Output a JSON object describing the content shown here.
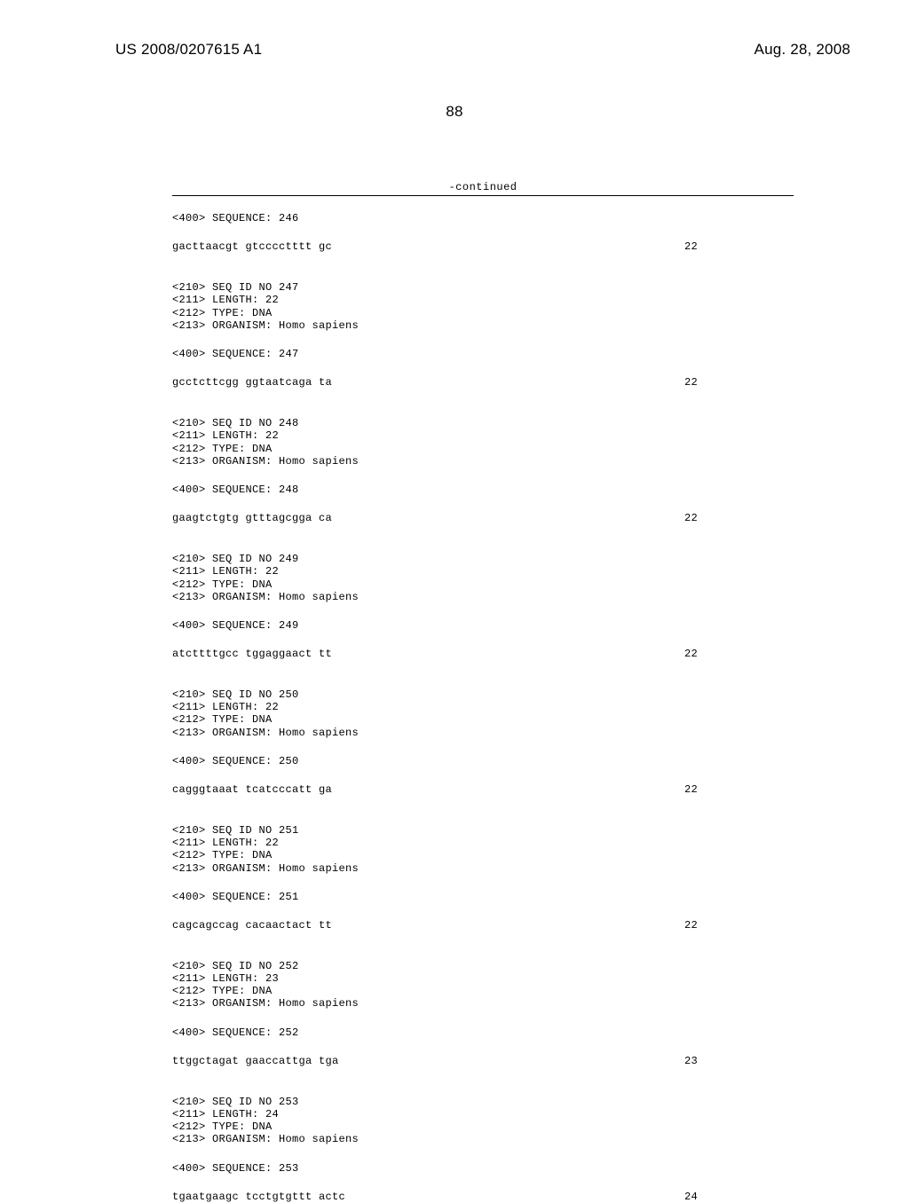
{
  "header": {
    "pub_number": "US 2008/0207615 A1",
    "pub_date": "Aug. 28, 2008"
  },
  "page_number": "88",
  "continued_label": "-continued",
  "sequences": [
    {
      "pre_header": [],
      "seq_label": "<400> SEQUENCE: 246",
      "seq_text": "gacttaacgt gtcccctttt gc",
      "seq_len": "22"
    },
    {
      "pre_header": [
        "<210> SEQ ID NO 247",
        "<211> LENGTH: 22",
        "<212> TYPE: DNA",
        "<213> ORGANISM: Homo sapiens"
      ],
      "seq_label": "<400> SEQUENCE: 247",
      "seq_text": "gcctcttcgg ggtaatcaga ta",
      "seq_len": "22"
    },
    {
      "pre_header": [
        "<210> SEQ ID NO 248",
        "<211> LENGTH: 22",
        "<212> TYPE: DNA",
        "<213> ORGANISM: Homo sapiens"
      ],
      "seq_label": "<400> SEQUENCE: 248",
      "seq_text": "gaagtctgtg gtttagcgga ca",
      "seq_len": "22"
    },
    {
      "pre_header": [
        "<210> SEQ ID NO 249",
        "<211> LENGTH: 22",
        "<212> TYPE: DNA",
        "<213> ORGANISM: Homo sapiens"
      ],
      "seq_label": "<400> SEQUENCE: 249",
      "seq_text": "atcttttgcc tggaggaact tt",
      "seq_len": "22"
    },
    {
      "pre_header": [
        "<210> SEQ ID NO 250",
        "<211> LENGTH: 22",
        "<212> TYPE: DNA",
        "<213> ORGANISM: Homo sapiens"
      ],
      "seq_label": "<400> SEQUENCE: 250",
      "seq_text": "cagggtaaat tcatcccatt ga",
      "seq_len": "22"
    },
    {
      "pre_header": [
        "<210> SEQ ID NO 251",
        "<211> LENGTH: 22",
        "<212> TYPE: DNA",
        "<213> ORGANISM: Homo sapiens"
      ],
      "seq_label": "<400> SEQUENCE: 251",
      "seq_text": "cagcagccag cacaactact tt",
      "seq_len": "22"
    },
    {
      "pre_header": [
        "<210> SEQ ID NO 252",
        "<211> LENGTH: 23",
        "<212> TYPE: DNA",
        "<213> ORGANISM: Homo sapiens"
      ],
      "seq_label": "<400> SEQUENCE: 252",
      "seq_text": "ttggctagat gaaccattga tga",
      "seq_len": "23"
    },
    {
      "pre_header": [
        "<210> SEQ ID NO 253",
        "<211> LENGTH: 24",
        "<212> TYPE: DNA",
        "<213> ORGANISM: Homo sapiens"
      ],
      "seq_label": "<400> SEQUENCE: 253",
      "seq_text": "tgaatgaagc tcctgtgttt actc",
      "seq_len": "24"
    }
  ]
}
